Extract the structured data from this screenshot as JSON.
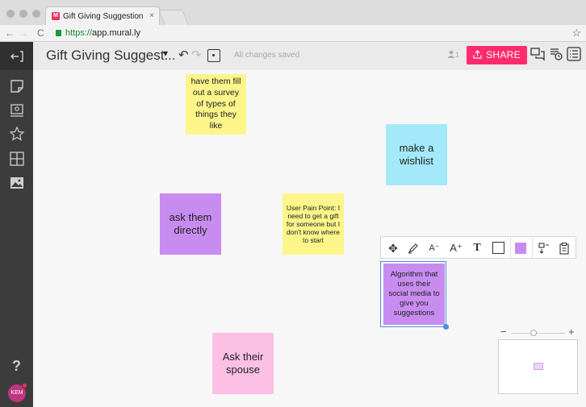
{
  "browser": {
    "tab_title": "Gift Giving Suggestion - Prod",
    "tab_close": "×",
    "url_scheme": "https://",
    "url_host": "app.mural.ly",
    "back": "←",
    "forward": "→",
    "reload": "C",
    "bookmark": "☆",
    "favicon_letter": "M"
  },
  "header": {
    "title": "Gift Giving Suggest...",
    "dropdown": "▾",
    "undo": "↶",
    "redo": "↷",
    "status": "All changes saved",
    "people_count": "1",
    "share_label": "SHARE"
  },
  "rail": {
    "help": "?",
    "avatar_initials": "KEM"
  },
  "notes": [
    {
      "text": "have them fill out a survey of types of things they like",
      "color": "yellow"
    },
    {
      "text": "make a wishlist",
      "color": "cyan"
    },
    {
      "text": "ask them directly",
      "color": "purple"
    },
    {
      "text": "User Pain Point: I need to get a gift for someone but I don't know where to start",
      "color": "yellow"
    },
    {
      "text": "Algorithm that uses their social media to give you suggestions",
      "color": "purple"
    },
    {
      "text": "Ask their spouse",
      "color": "pink"
    }
  ],
  "toolbar": {
    "move": "✥",
    "font_smaller": "A⁻",
    "font_larger": "A⁺",
    "text": "T"
  },
  "zoom": {
    "minus": "−",
    "plus": "+"
  },
  "colors": {
    "accent": "#ff2b6e",
    "yellow": "#fbf58a",
    "purple": "#c88cf0",
    "cyan": "#a4e9f9",
    "pink": "#fcc0e4"
  }
}
